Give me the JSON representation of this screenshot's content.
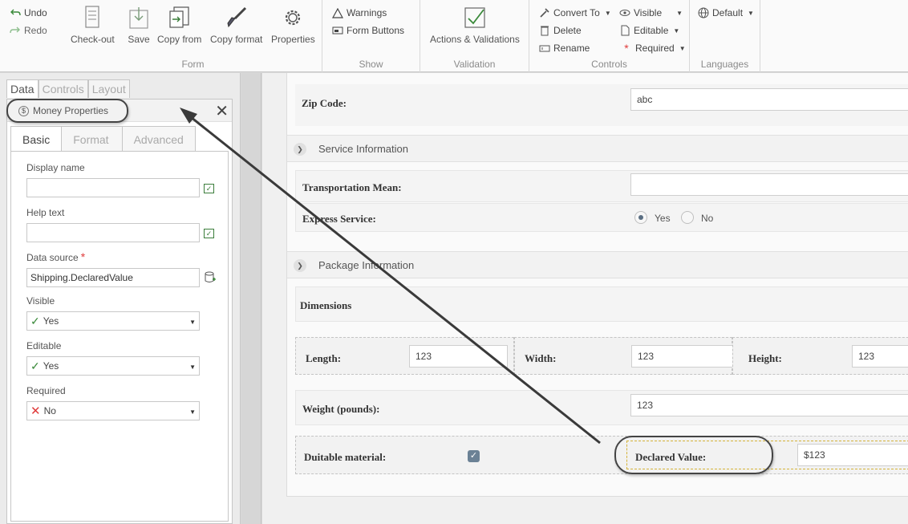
{
  "ribbon": {
    "undo": "Undo",
    "redo": "Redo",
    "form_group": {
      "label": "Form",
      "checkout": "Check-out",
      "save": "Save",
      "copy_from": "Copy from",
      "copy_format": "Copy format",
      "properties": "Properties"
    },
    "show_group": {
      "label": "Show",
      "warnings": "Warnings",
      "form_buttons": "Form Buttons"
    },
    "validation_group": {
      "label": "Validation",
      "actions": "Actions & Validations"
    },
    "controls_group": {
      "label": "Controls",
      "convert_to": "Convert To",
      "delete": "Delete",
      "rename": "Rename",
      "visible": "Visible",
      "editable": "Editable",
      "required": "Required"
    },
    "languages_group": {
      "label": "Languages",
      "default": "Default"
    }
  },
  "left_panel": {
    "tabs": [
      "Data",
      "Controls",
      "Layout"
    ],
    "props_title": "Money Properties",
    "inner_tabs": [
      "Basic",
      "Format",
      "Advanced"
    ],
    "fields": {
      "display_name_label": "Display name",
      "display_name_value": "",
      "help_text_label": "Help text",
      "help_text_value": "",
      "data_source_label": "Data source",
      "data_source_value": "Shipping.DeclaredValue",
      "visible_label": "Visible",
      "visible_value": "Yes",
      "editable_label": "Editable",
      "editable_value": "Yes",
      "required_label": "Required",
      "required_value": "No"
    }
  },
  "form": {
    "zip_label": "Zip Code:",
    "zip_value": "abc",
    "service_section": "Service Information",
    "transport_label": "Transportation Mean:",
    "transport_value": "",
    "express_label": "Express Service:",
    "yes": "Yes",
    "no": "No",
    "package_section": "Package Information",
    "dimensions": "Dimensions",
    "length_label": "Length:",
    "length_value": "123",
    "width_label": "Width:",
    "width_value": "123",
    "height_label": "Height:",
    "height_value": "123",
    "weight_label": "Weight (pounds):",
    "weight_value": "123",
    "duitable_label": "Duitable material:",
    "declared_label": "Declared Value:",
    "declared_value": "$123"
  },
  "colors": {
    "required_star": "#e03b3b",
    "check_green": "#3a7d3a",
    "radio_selected": "#5a6e82"
  }
}
